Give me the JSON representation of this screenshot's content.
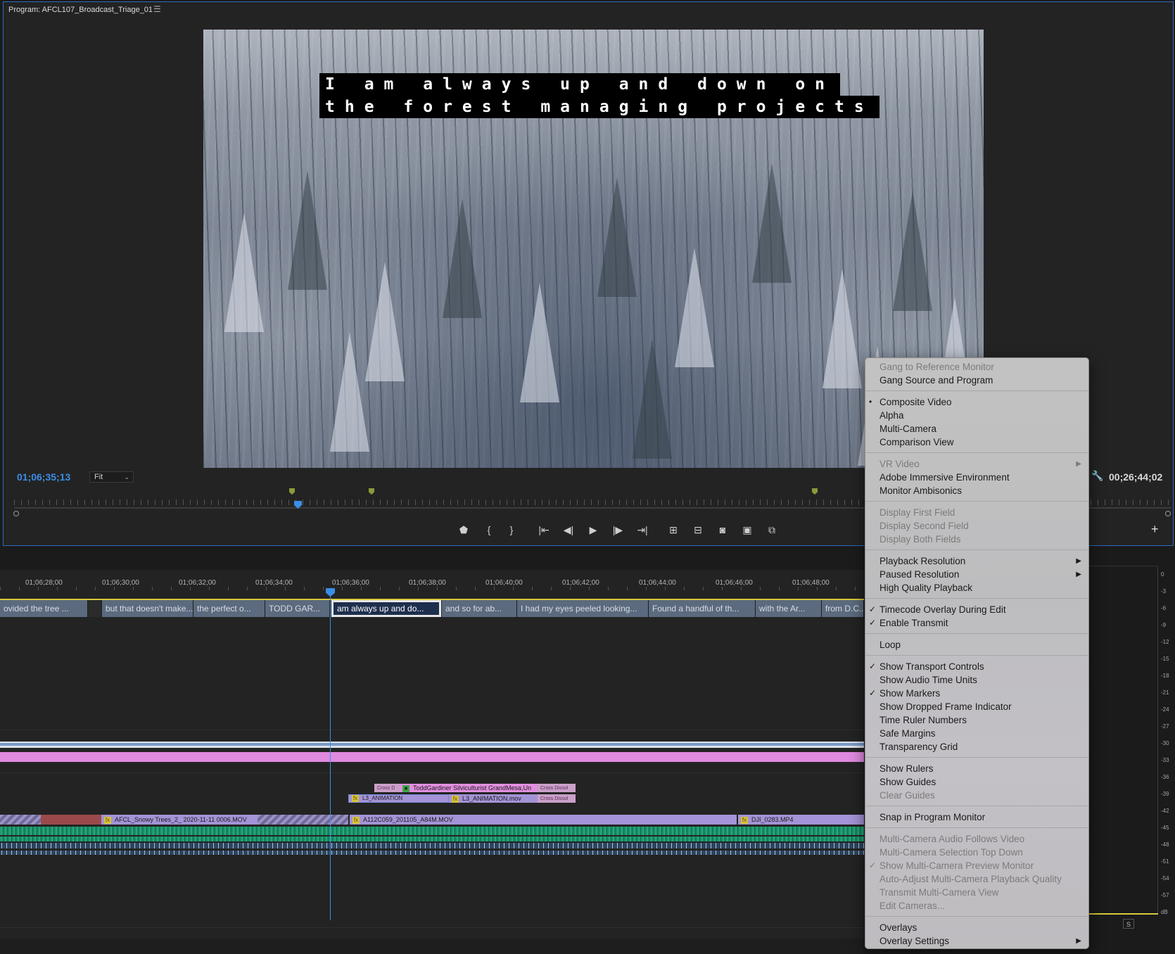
{
  "monitor": {
    "title": "Program: AFCL107_Broadcast_Triage_01",
    "caption_line_1": "I am always up and down on",
    "caption_line_2": "the forest managing projects",
    "timecode_current": "01;06;35;13",
    "zoom": "Fit",
    "timecode_duration": "00;26;44;02",
    "icons": {
      "panel_menu": "hamburger-icon",
      "wrench": "wrench-icon",
      "add": "plus-icon"
    }
  },
  "timeline": {
    "ruler_times": [
      "01;06;28;00",
      "01;06;30;00",
      "01;06;32;00",
      "01;06;34;00",
      "01;06;36;00",
      "01;06;38;00",
      "01;06;40;00",
      "01;06;42;00",
      "01;06;44;00",
      "01;06;46;00",
      "01;06;48;00"
    ],
    "caption_clips": [
      "ovided the tree ...",
      "",
      "but that doesn't make...",
      "the perfect o...",
      "TODD GAR...",
      "am always up and do...",
      "and so for ab...",
      "I had my eyes peeled looking...",
      "Found a handful of th...",
      "with the Ar...",
      "from D.C..."
    ],
    "clips": {
      "todd_title": "ToddGardiner Silviculturist GrandMesa,Un",
      "cross_dissolve_a": "Cross D",
      "cross_dissolve_b": "Cross Dissol",
      "cross_dissolve_c": "Cross Dissol",
      "l3_a": "L3_ANIMATION",
      "l3_b": "L3_ANIMATION.mov",
      "snowy_trees": "AFCL_Snowy Trees_2_ 2020-11-11 0006.MOV",
      "a112": "A112C059_201105_A84M.MOV",
      "dji": "DJI_0283.MP4"
    },
    "colors": {
      "playhead": "#3a8ee6",
      "caption_clip": "#5b6a7e",
      "video_clip": "#a493d6",
      "title_clip": "#e28fe0",
      "pink_track": "#e08ae0",
      "audio": "#1f9a70"
    }
  },
  "meter": {
    "labels": [
      "0",
      "-3",
      "-6",
      "-9",
      "-12",
      "-15",
      "-18",
      "-21",
      "-24",
      "-27",
      "-30",
      "-33",
      "-36",
      "-39",
      "-42",
      "-45",
      "-48",
      "-51",
      "-54",
      "-57",
      "dB"
    ],
    "solo": "S"
  },
  "context_menu": {
    "groups": [
      [
        {
          "label": "Gang to Reference Monitor",
          "enabled": false
        },
        {
          "label": "Gang Source and Program",
          "enabled": true
        }
      ],
      [
        {
          "label": "Composite Video",
          "enabled": true,
          "mark": "•"
        },
        {
          "label": "Alpha",
          "enabled": true
        },
        {
          "label": "Multi-Camera",
          "enabled": true
        },
        {
          "label": "Comparison View",
          "enabled": true
        }
      ],
      [
        {
          "label": "VR Video",
          "enabled": false,
          "submenu": true
        },
        {
          "label": "Adobe Immersive Environment",
          "enabled": true
        },
        {
          "label": "Monitor Ambisonics",
          "enabled": true
        }
      ],
      [
        {
          "label": "Display First Field",
          "enabled": false
        },
        {
          "label": "Display Second Field",
          "enabled": false
        },
        {
          "label": "Display Both Fields",
          "enabled": false
        }
      ],
      [
        {
          "label": "Playback Resolution",
          "enabled": true,
          "submenu": true
        },
        {
          "label": "Paused Resolution",
          "enabled": true,
          "submenu": true
        },
        {
          "label": "High Quality Playback",
          "enabled": true
        }
      ],
      [
        {
          "label": "Timecode Overlay During Edit",
          "enabled": true,
          "mark": "✓"
        },
        {
          "label": "Enable Transmit",
          "enabled": true,
          "mark": "✓"
        }
      ],
      [
        {
          "label": "Loop",
          "enabled": true
        }
      ],
      [
        {
          "label": "Show Transport Controls",
          "enabled": true,
          "mark": "✓"
        },
        {
          "label": "Show Audio Time Units",
          "enabled": true
        },
        {
          "label": "Show Markers",
          "enabled": true,
          "mark": "✓"
        },
        {
          "label": "Show Dropped Frame Indicator",
          "enabled": true
        },
        {
          "label": "Time Ruler Numbers",
          "enabled": true
        },
        {
          "label": "Safe Margins",
          "enabled": true
        },
        {
          "label": "Transparency Grid",
          "enabled": true
        }
      ],
      [
        {
          "label": "Show Rulers",
          "enabled": true
        },
        {
          "label": "Show Guides",
          "enabled": true
        },
        {
          "label": "Clear Guides",
          "enabled": false
        }
      ],
      [
        {
          "label": "Snap in Program Monitor",
          "enabled": true
        }
      ],
      [
        {
          "label": "Multi-Camera Audio Follows Video",
          "enabled": false
        },
        {
          "label": "Multi-Camera Selection Top Down",
          "enabled": false
        },
        {
          "label": "Show Multi-Camera Preview Monitor",
          "enabled": false,
          "mark": "✓"
        },
        {
          "label": "Auto-Adjust Multi-Camera Playback Quality",
          "enabled": false
        },
        {
          "label": "Transmit Multi-Camera View",
          "enabled": false
        },
        {
          "label": "Edit Cameras...",
          "enabled": false
        }
      ],
      [
        {
          "label": "Overlays",
          "enabled": true
        },
        {
          "label": "Overlay Settings",
          "enabled": true,
          "submenu": true
        }
      ]
    ]
  }
}
